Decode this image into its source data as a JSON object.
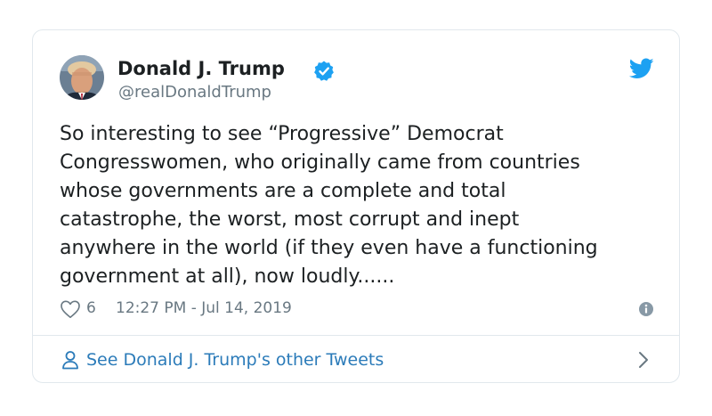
{
  "author": {
    "name": "Donald J. Trump",
    "handle": "@realDonaldTrump",
    "avatar_icon": "profile-photo",
    "verified_icon": "verified-badge-icon"
  },
  "tweet": {
    "text": "So interesting to see “Progressive” Democrat\nCongresswomen, who originally came from countries\nwhose governments are a complete and total\ncatastrophe, the worst, most corrupt and inept\nanywhere in the world (if they even have a functioning\ngovernment at all), now loudly......",
    "likes": "6",
    "timestamp": "12:27 PM - Jul 14, 2019"
  },
  "footer": {
    "see_more_label": "See Donald J. Trump's other Tweets"
  },
  "icons": {
    "platform": "twitter-bird-icon",
    "like": "heart-icon",
    "info": "info-icon",
    "person": "person-icon",
    "chevron": "chevron-right-icon"
  },
  "colors": {
    "brand": "#1da1f2",
    "link": "#2b7bb9",
    "muted": "#697882",
    "text": "#1c2022",
    "border": "#e1e8ed"
  }
}
